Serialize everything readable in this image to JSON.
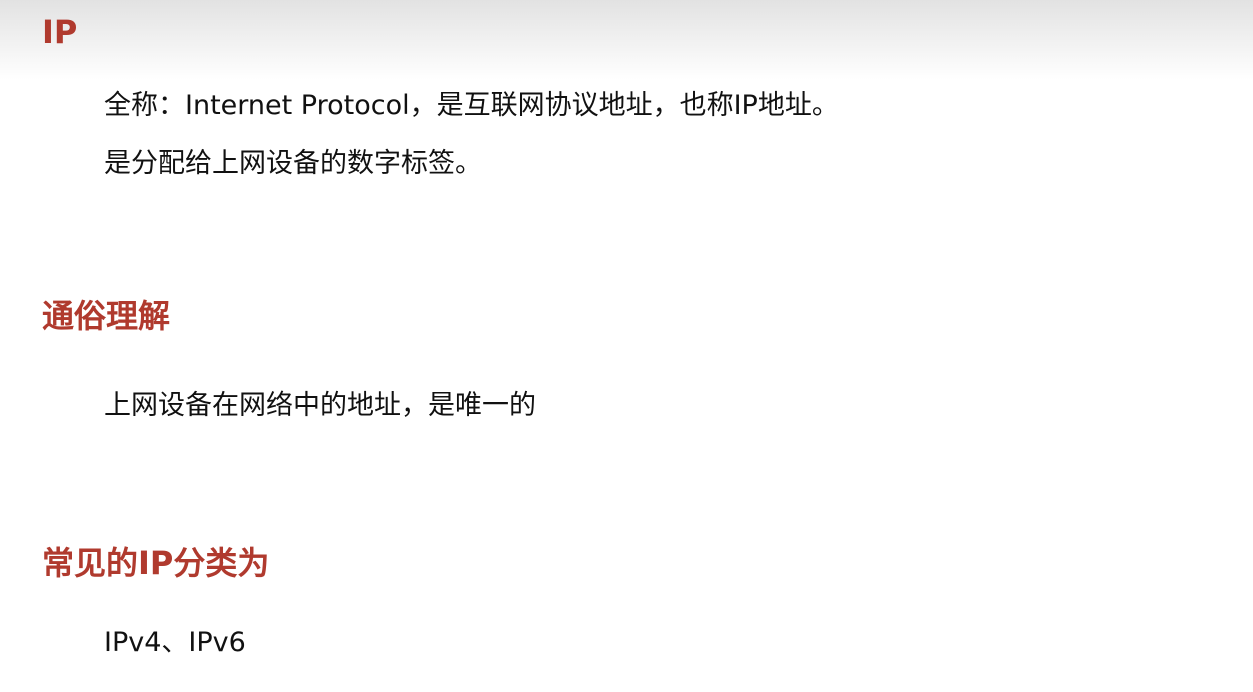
{
  "colors": {
    "heading": "#b03a2e",
    "text": "#111111"
  },
  "sections": [
    {
      "heading": "IP",
      "lines": [
        "全称：Internet Protocol，是互联网协议地址，也称IP地址。",
        "是分配给上网设备的数字标签。"
      ]
    },
    {
      "heading": "通俗理解",
      "lines": [
        "上网设备在网络中的地址，是唯一的"
      ]
    },
    {
      "heading": "常见的IP分类为",
      "lines": [
        "IPv4、IPv6"
      ]
    }
  ]
}
